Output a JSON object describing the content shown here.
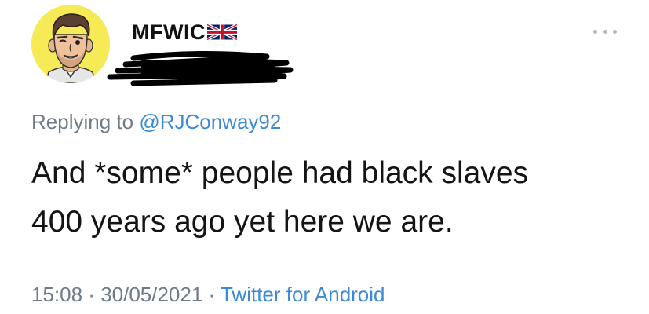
{
  "author": {
    "display_name": "MFWIC",
    "flag_icon": "uk-flag-icon",
    "avatar_icon": "cartoon-avatar-icon",
    "avatar_bg": "#f7ea57"
  },
  "reply": {
    "prefix": "Replying to",
    "mention": "@RJConway92"
  },
  "tweet": {
    "line1": "And *some* people had black slaves",
    "line2": "400 years ago yet here we are."
  },
  "meta": {
    "time": "15:08",
    "separator": " · ",
    "date": "30/05/2021",
    "source": "Twitter for Android"
  },
  "colors": {
    "text": "#141414",
    "secondary": "#6f7c88",
    "link": "#3c8ad5"
  }
}
